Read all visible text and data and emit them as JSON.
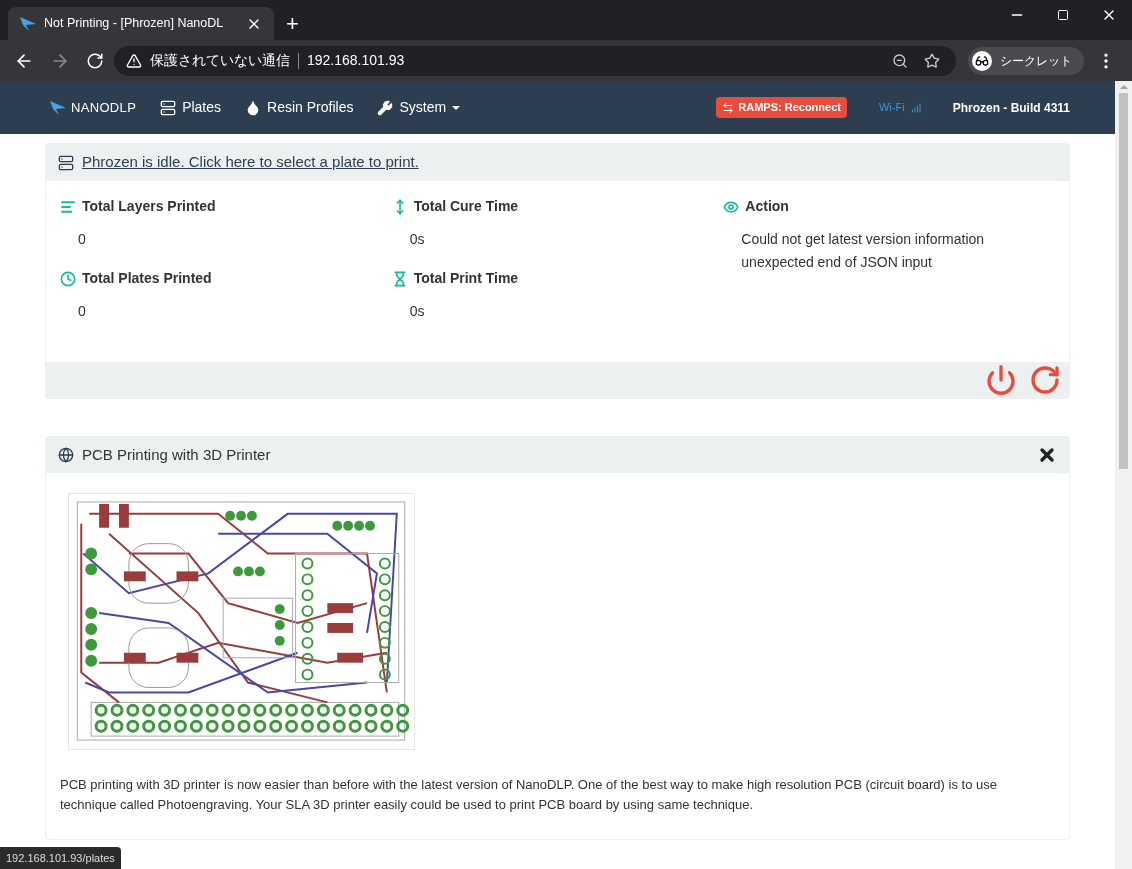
{
  "browser": {
    "tab_title": "Not Printing - [Phrozen] NanoDL",
    "new_tab": "+",
    "security_label": "保護されていない通信",
    "url": "192.168.101.93",
    "profile_label": "シークレット"
  },
  "navbar": {
    "brand": "NANODLP",
    "items": [
      {
        "label": "Plates",
        "kind": "plates",
        "dropdown": false
      },
      {
        "label": "Resin Profiles",
        "kind": "resin",
        "dropdown": false
      },
      {
        "label": "System",
        "kind": "system",
        "dropdown": true
      }
    ],
    "badge": "RAMPS: Reconnect",
    "wifi": "Wi-Fi",
    "build": "Phrozen - Build 4311"
  },
  "status_card": {
    "header_link": "Phrozen is idle. Click here to select a plate to print.",
    "columns": [
      {
        "items": [
          {
            "kind": "layers",
            "label": "Total Layers Printed",
            "lines": [
              "0"
            ]
          },
          {
            "kind": "plates",
            "label": "Total Plates Printed",
            "lines": [
              "0"
            ]
          }
        ]
      },
      {
        "items": [
          {
            "kind": "cure",
            "label": "Total Cure Time",
            "lines": [
              "0s"
            ]
          },
          {
            "kind": "time",
            "label": "Total Print Time",
            "lines": [
              "0s"
            ]
          }
        ]
      },
      {
        "items": [
          {
            "kind": "action",
            "label": "Action",
            "lines": [
              "Could not get latest version information",
              "unexpected end of JSON input"
            ]
          }
        ]
      }
    ]
  },
  "news_card": {
    "title": "PCB Printing with 3D Printer",
    "body": "PCB printing with 3D printer is now easier than before with the latest version of NanoDLP. One of the best way to make high resolution PCB (circuit board) is to use technique called Photoengraving. Your SLA 3D printer easily could be used to print PCB board by using same technique."
  },
  "status_url": "192.168.101.93/plates"
}
